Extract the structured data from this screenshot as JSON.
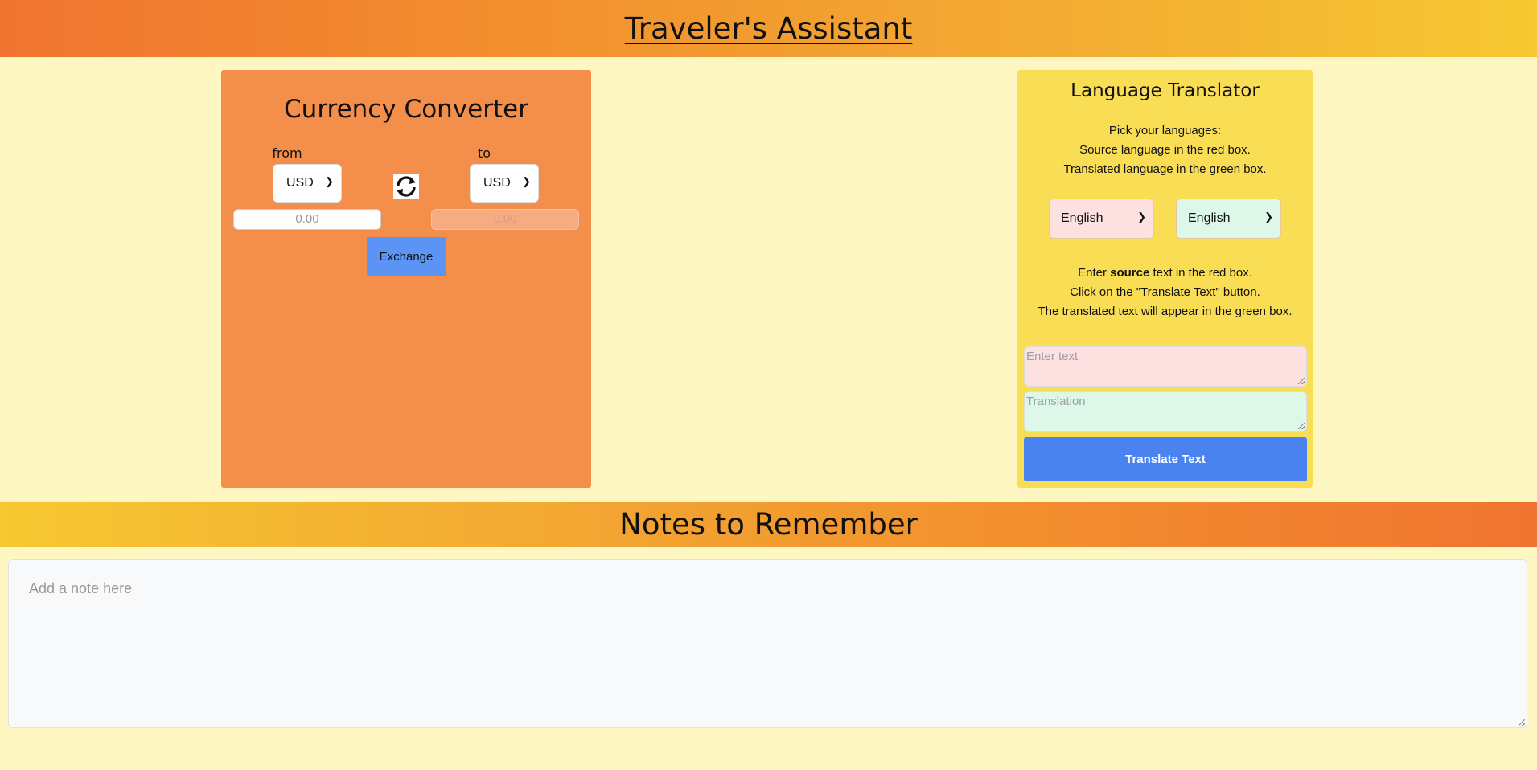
{
  "header": {
    "title": "Traveler's Assistant"
  },
  "currency": {
    "title": "Currency Converter",
    "from_label": "from",
    "to_label": "to",
    "from_currency": "USD",
    "to_currency": "USD",
    "from_amount_placeholder": "0.00",
    "to_amount_placeholder": "0.00",
    "exchange_label": "Exchange",
    "swap_icon": "swap-arrows-icon"
  },
  "translator": {
    "title": "Language Translator",
    "pick_line1": "Pick your languages:",
    "pick_line2": "Source language in the red box.",
    "pick_line3": "Translated language in the green box.",
    "source_language": "English",
    "target_language": "English",
    "enter_prefix": "Enter ",
    "enter_bold": "source",
    "enter_suffix": " text in the red box.",
    "click_line": "Click on the \"Translate Text\" button.",
    "appear_line": "The translated text will appear in the green box.",
    "source_placeholder": "Enter text",
    "target_placeholder": "Translation",
    "button_label": "Translate Text"
  },
  "notes": {
    "title": "Notes to Remember",
    "placeholder": "Add a note here"
  }
}
